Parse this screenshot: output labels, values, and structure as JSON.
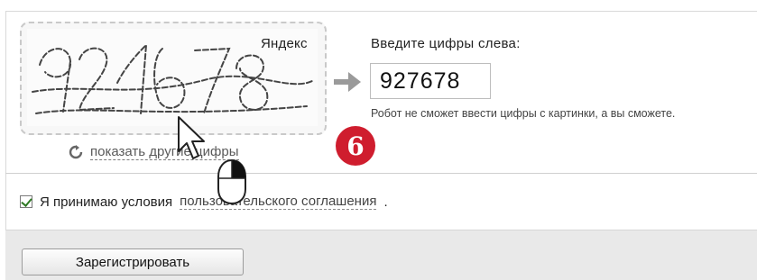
{
  "captcha": {
    "brand": "Яндекс",
    "refresh_label": "показать другие цифры"
  },
  "form": {
    "prompt": "Введите цифры слева:",
    "code_value": "927678",
    "hint": "Робот не сможет ввести цифры с картинки, а вы сможете."
  },
  "badge": {
    "number": "6"
  },
  "agreement": {
    "prefix": "Я принимаю условия ",
    "link": "пользовательского соглашения",
    "suffix": ".",
    "checked": true
  },
  "actions": {
    "submit_label": "Зарегистрировать"
  },
  "colors": {
    "badge": "#cf1d2e",
    "checkmark": "#2f7a25"
  }
}
